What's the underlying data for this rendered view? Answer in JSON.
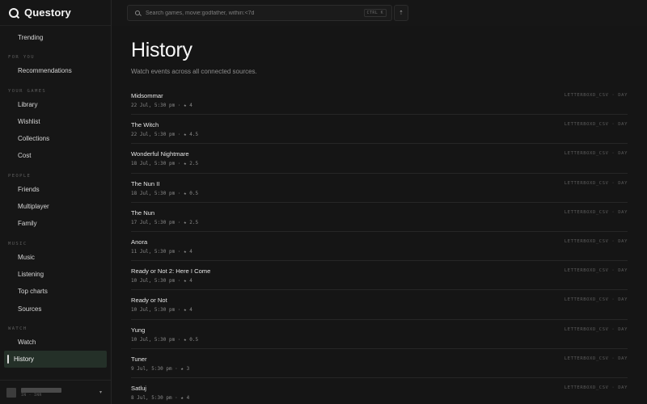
{
  "brand": {
    "name": "Questory",
    "logo_icon": "questory-logo-icon"
  },
  "search": {
    "placeholder": "Search games, movie:godfather, within:<7d",
    "shortcut": "CTRL K"
  },
  "topbar": {
    "action_icon": "rocket-icon"
  },
  "sidebar": {
    "top_items": [
      {
        "label": "Trending"
      }
    ],
    "groups": [
      {
        "label": "FOR YOU",
        "items": [
          {
            "label": "Recommendations"
          }
        ]
      },
      {
        "label": "YOUR GAMES",
        "items": [
          {
            "label": "Library"
          },
          {
            "label": "Wishlist"
          },
          {
            "label": "Collections"
          },
          {
            "label": "Cost"
          }
        ]
      },
      {
        "label": "PEOPLE",
        "items": [
          {
            "label": "Friends"
          },
          {
            "label": "Multiplayer"
          },
          {
            "label": "Family"
          }
        ]
      },
      {
        "label": "MUSIC",
        "items": [
          {
            "label": "Music"
          },
          {
            "label": "Listening"
          },
          {
            "label": "Top charts"
          },
          {
            "label": "Sources"
          }
        ]
      },
      {
        "label": "WATCH",
        "items": [
          {
            "label": "Watch"
          },
          {
            "label": "History",
            "active": true
          }
        ]
      }
    ],
    "account": {
      "meta": "IN · INR"
    }
  },
  "page": {
    "title": "History",
    "subtitle": "Watch events across all connected sources."
  },
  "history": [
    {
      "title": "Midsommar",
      "meta": "22 Jul, 5:30 pm · ★ 4",
      "source": "LETTERBOXD_CSV · DAY"
    },
    {
      "title": "The Witch",
      "meta": "22 Jul, 5:30 pm · ★ 4.5",
      "source": "LETTERBOXD_CSV · DAY"
    },
    {
      "title": "Wonderful Nightmare",
      "meta": "18 Jul, 5:30 pm · ★ 2.5",
      "source": "LETTERBOXD_CSV · DAY"
    },
    {
      "title": "The Nun II",
      "meta": "18 Jul, 5:30 pm · ★ 0.5",
      "source": "LETTERBOXD_CSV · DAY"
    },
    {
      "title": "The Nun",
      "meta": "17 Jul, 5:30 pm · ★ 2.5",
      "source": "LETTERBOXD_CSV · DAY"
    },
    {
      "title": "Anora",
      "meta": "11 Jul, 5:30 pm · ★ 4",
      "source": "LETTERBOXD_CSV · DAY"
    },
    {
      "title": "Ready or Not 2: Here I Come",
      "meta": "10 Jul, 5:30 pm · ★ 4",
      "source": "LETTERBOXD_CSV · DAY"
    },
    {
      "title": "Ready or Not",
      "meta": "10 Jul, 5:30 pm · ★ 4",
      "source": "LETTERBOXD_CSV · DAY"
    },
    {
      "title": "Yung",
      "meta": "10 Jul, 5:30 pm · ★ 0.5",
      "source": "LETTERBOXD_CSV · DAY"
    },
    {
      "title": "Tuner",
      "meta": "9 Jul, 5:30 pm · ★ 3",
      "source": "LETTERBOXD_CSV · DAY"
    },
    {
      "title": "Satluj",
      "meta": "8 Jul, 5:30 pm · ★ 4",
      "source": "LETTERBOXD_CSV · DAY"
    }
  ]
}
